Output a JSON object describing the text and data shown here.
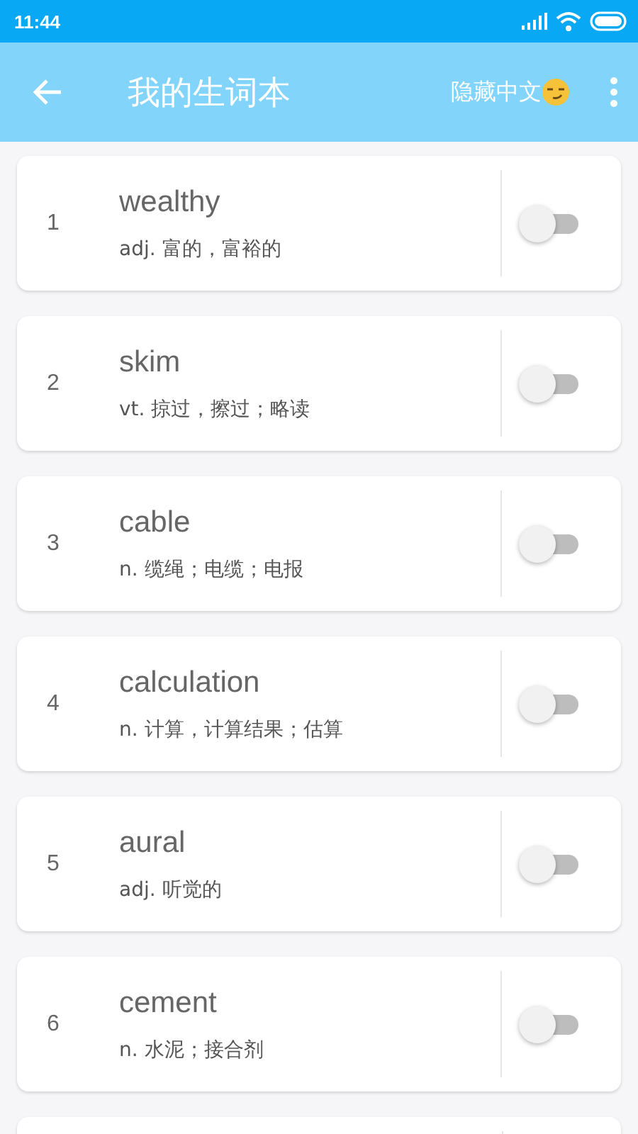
{
  "status_bar": {
    "time": "11:44"
  },
  "toolbar": {
    "title": "我的生词本",
    "action": "隐藏中文"
  },
  "words": [
    {
      "index": "1",
      "word": "wealthy",
      "meaning": "adj. 富的，富裕的",
      "checked": false
    },
    {
      "index": "2",
      "word": "skim",
      "meaning": "vt. 掠过，擦过；略读",
      "checked": false
    },
    {
      "index": "3",
      "word": "cable",
      "meaning": "n. 缆绳；电缆；电报",
      "checked": false
    },
    {
      "index": "4",
      "word": "calculation",
      "meaning": "n. 计算，计算结果；估算",
      "checked": false
    },
    {
      "index": "5",
      "word": "aural",
      "meaning": "adj. 听觉的",
      "checked": false
    },
    {
      "index": "6",
      "word": "cement",
      "meaning": "n. 水泥；接合剂",
      "checked": false
    }
  ]
}
